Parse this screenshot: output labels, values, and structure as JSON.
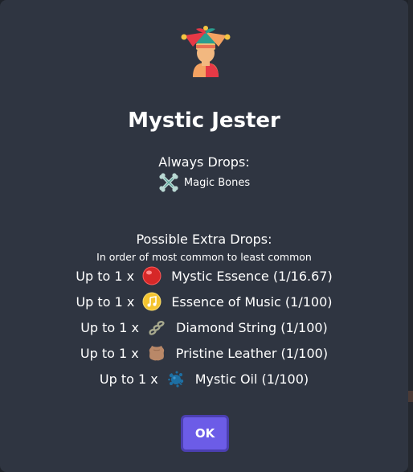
{
  "modal": {
    "title": "Mystic Jester",
    "avatar_icon": "jester-icon",
    "always_drops_heading": "Always Drops:",
    "always_drops": [
      {
        "name": "Magic Bones",
        "icon": "bones-icon"
      }
    ],
    "extra_drops_heading": "Possible Extra Drops:",
    "extra_drops_note": "In order of most common to least common",
    "extra_drops": [
      {
        "qty": "Up to 1 x",
        "name": "Mystic Essence (1/16.67)",
        "icon": "red-orb-icon"
      },
      {
        "qty": "Up to 1 x",
        "name": "Essence of Music (1/100)",
        "icon": "music-note-icon"
      },
      {
        "qty": "Up to 1 x",
        "name": "Diamond String (1/100)",
        "icon": "string-icon"
      },
      {
        "qty": "Up to 1 x",
        "name": "Pristine Leather (1/100)",
        "icon": "leather-icon"
      },
      {
        "qty": "Up to 1 x",
        "name": "Mystic Oil (1/100)",
        "icon": "oil-splat-icon"
      }
    ],
    "ok_label": "OK"
  },
  "colors": {
    "modal_bg": "#2f3541",
    "button_bg": "#6c5ce7",
    "text": "#ffffff"
  }
}
